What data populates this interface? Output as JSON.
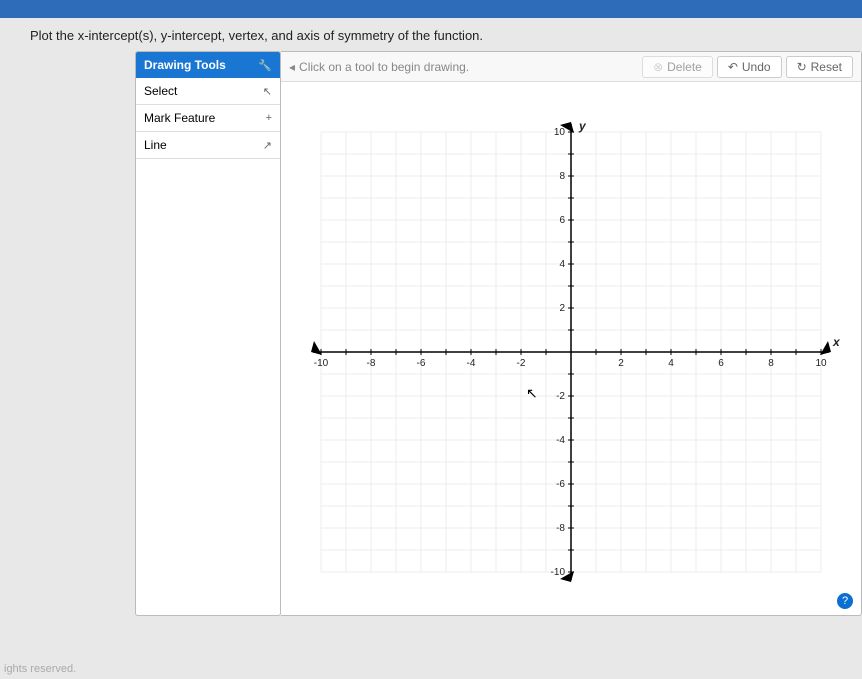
{
  "instruction": "Plot the x-intercept(s), y-intercept, vertex, and axis of symmetry of the function.",
  "panel": {
    "title": "Drawing Tools",
    "items": [
      {
        "label": "Select",
        "icon": "↖"
      },
      {
        "label": "Mark Feature",
        "icon": "+"
      },
      {
        "label": "Line",
        "icon": "↗"
      }
    ]
  },
  "canvas": {
    "hint": "Click on a tool to begin drawing.",
    "buttons": {
      "delete": "Delete",
      "undo": "Undo",
      "reset": "Reset"
    }
  },
  "chart_data": {
    "type": "scatter",
    "title": "",
    "xlabel": "x",
    "ylabel": "y",
    "xlim": [
      -10,
      10
    ],
    "ylim": [
      -10,
      10
    ],
    "xticks": [
      -10,
      -8,
      -6,
      -4,
      -2,
      2,
      4,
      6,
      8,
      10
    ],
    "yticks": [
      -10,
      -8,
      -6,
      -4,
      -2,
      2,
      4,
      6,
      8,
      10
    ],
    "series": []
  },
  "footer": "ights reserved."
}
